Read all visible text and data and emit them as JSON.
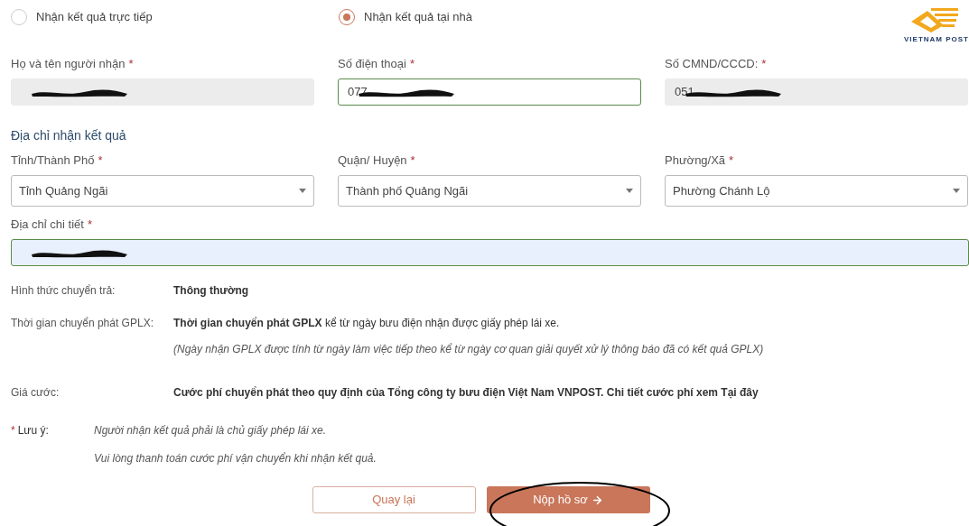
{
  "delivery_options": [
    {
      "label": "Nhận kết quả trực tiếp",
      "selected": false
    },
    {
      "label": "Nhận kết quả tại nhà",
      "selected": true
    }
  ],
  "logo": {
    "text": "VIETNAM POST"
  },
  "recipient_fields": [
    {
      "label": "Họ và tên người nhận",
      "required": true,
      "kind": "text",
      "readonly": true,
      "focused": false,
      "redacted": true
    },
    {
      "label": "Số điện thoại",
      "required": true,
      "kind": "text",
      "value": "077",
      "readonly": false,
      "focused": true,
      "redacted": true
    },
    {
      "label": "Số CMND/CCCD:",
      "required": true,
      "kind": "text",
      "value": "051",
      "readonly": true,
      "focused": false,
      "redacted": true
    }
  ],
  "address_section": {
    "title": "Địa chỉ nhận kết quả",
    "fields": [
      {
        "label": "Tỉnh/Thành Phố",
        "required": true,
        "kind": "select",
        "value": "Tỉnh Quảng Ngãi"
      },
      {
        "label": "Quận/ Huyện",
        "required": true,
        "kind": "select",
        "value": "Thành phố Quảng Ngãi"
      },
      {
        "label": "Phường/Xã",
        "required": true,
        "kind": "select",
        "value": "Phường Chánh Lộ"
      }
    ],
    "detail": {
      "label": "Địa chỉ chi tiết",
      "required": true,
      "kind": "text",
      "focused": true,
      "autofilled": true,
      "redacted": true
    }
  },
  "info_rows": [
    {
      "label": "Hình thức chuyển trả:",
      "value": "Thông thường",
      "bold": true
    },
    {
      "label": "Thời gian chuyển phát GPLX:",
      "value": "**Thời gian chuyển phát GPLX** kể từ ngày bưu điện nhận được giấy phép lái xe.",
      "bold": false,
      "note": "(Ngày nhận GPLX được tính từ ngày làm việc tiếp theo kể từ ngày cơ quan giải quyết xử lý thông báo đã có kết quả GPLX)"
    },
    {
      "label": "Giá cước:",
      "value": "Cước phí chuyển phát theo quy định của Tổng công ty bưu điện Việt Nam VNPOST. Chi tiết cước phí xem Tại đây",
      "bold": true
    }
  ],
  "notice": {
    "marker": "*",
    "label": "Lưu ý:",
    "lines": [
      "Người nhận kết quả phải là chủ giấy phép lái xe.",
      "Vui lòng thanh toán cước phí vận chuyển khi nhận kết quả."
    ]
  },
  "buttons": [
    {
      "label": "Quay lại",
      "kind": "outline"
    },
    {
      "label": "Nộp hồ sơ",
      "kind": "primary"
    }
  ]
}
